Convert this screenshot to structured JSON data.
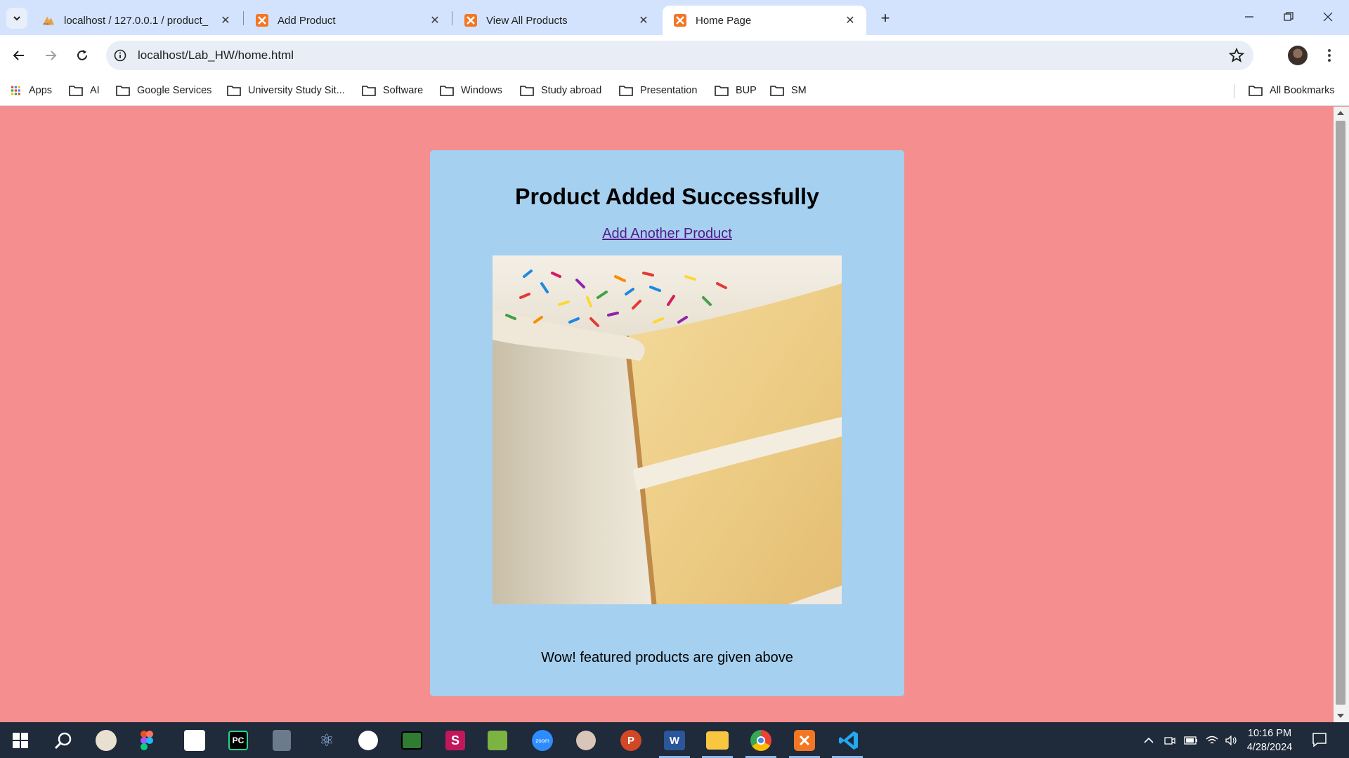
{
  "browser": {
    "tabs": [
      {
        "title": "localhost / 127.0.0.1 / product_",
        "favicon": "phpmyadmin-icon",
        "active": false
      },
      {
        "title": "Add Product",
        "favicon": "xampp-icon",
        "active": false
      },
      {
        "title": "View All Products",
        "favicon": "xampp-icon",
        "active": false
      },
      {
        "title": "Home Page",
        "favicon": "xampp-icon",
        "active": true
      }
    ],
    "url": "localhost/Lab_HW/home.html",
    "bookmarks": [
      {
        "label": "Apps",
        "icon": "apps-grid-icon"
      },
      {
        "label": "AI",
        "icon": "folder-icon"
      },
      {
        "label": "Google Services",
        "icon": "folder-icon"
      },
      {
        "label": "University Study Sit...",
        "icon": "folder-icon"
      },
      {
        "label": "Software",
        "icon": "folder-icon"
      },
      {
        "label": "Windows",
        "icon": "folder-icon"
      },
      {
        "label": "Study abroad",
        "icon": "folder-icon"
      },
      {
        "label": "Presentation",
        "icon": "folder-icon"
      },
      {
        "label": "BUP",
        "icon": "folder-icon"
      },
      {
        "label": "SM",
        "icon": "folder-icon"
      }
    ],
    "all_bookmarks": "All Bookmarks"
  },
  "page": {
    "heading": "Product Added Successfully",
    "link_text": "Add Another Product",
    "image_subject": "cake-slice-image",
    "footer_note": "Wow! featured products are given above",
    "colors": {
      "page_bg": "#f58e8e",
      "card_bg": "#a5d0ef",
      "link": "#551a8b"
    }
  },
  "taskbar": {
    "apps": [
      "start-icon",
      "search-icon",
      "paint-icon",
      "figma-icon",
      "mba-icon",
      "pycharm-icon",
      "calculator-icon",
      "ai-app-icon",
      "clock-app-icon",
      "terminal-icon",
      "slides-icon",
      "paint-net-icon",
      "zoom-icon",
      "cloud-app-icon",
      "powerpoint-icon",
      "word-icon",
      "file-explorer-icon",
      "chrome-icon",
      "xampp-icon",
      "vscode-icon"
    ],
    "time": "10:16 PM",
    "date": "4/28/2024"
  }
}
